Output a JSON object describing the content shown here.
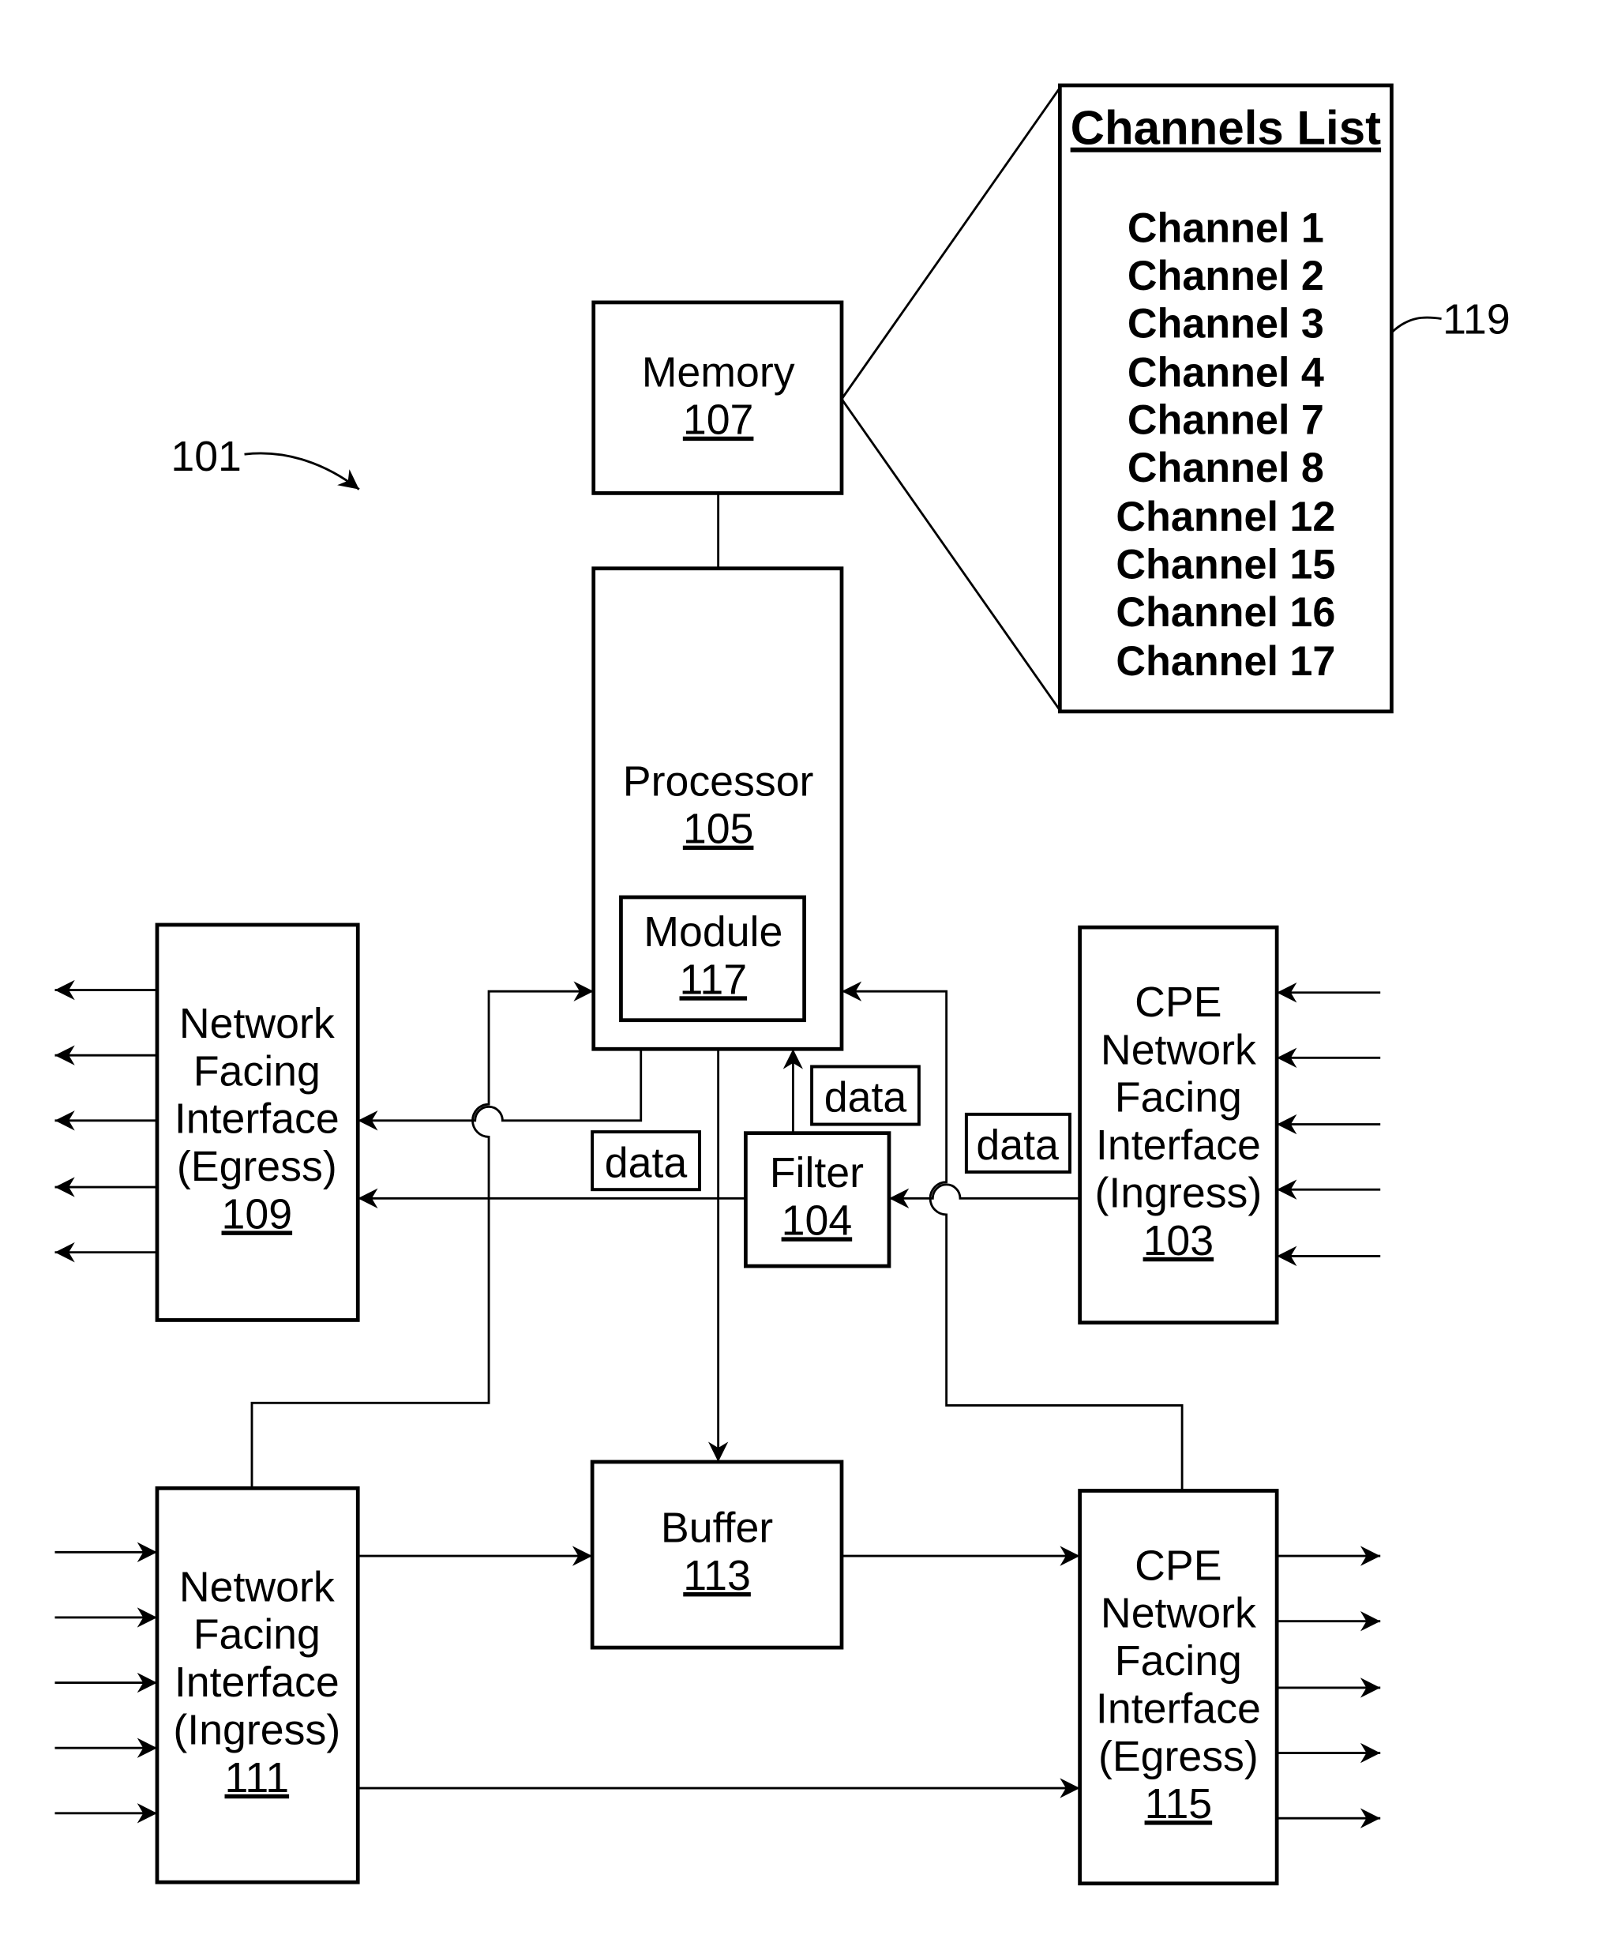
{
  "figure": {
    "reference_label": "101",
    "channels_list_ref": "119"
  },
  "blocks": {
    "memory": {
      "name": "Memory",
      "number": "107"
    },
    "processor": {
      "name": "Processor",
      "number": "105"
    },
    "module": {
      "name": "Module",
      "number": "117"
    },
    "filter": {
      "name": "Filter",
      "number": "104"
    },
    "buffer": {
      "name": "Buffer",
      "number": "113"
    },
    "nf_egress": {
      "lines": [
        "Network",
        "Facing",
        "Interface",
        "(Egress)"
      ],
      "number": "109"
    },
    "nf_ingress": {
      "lines": [
        "Network",
        "Facing",
        "Interface",
        "(Ingress)"
      ],
      "number": "111"
    },
    "cpe_ingress": {
      "lines": [
        "CPE",
        "Network",
        "Facing",
        "Interface",
        "(Ingress)"
      ],
      "number": "103"
    },
    "cpe_egress": {
      "lines": [
        "CPE",
        "Network",
        "Facing",
        "Interface",
        "(Egress)"
      ],
      "number": "115"
    }
  },
  "data_tags": [
    "data",
    "data",
    "data"
  ],
  "channels_list": {
    "title": "Channels List",
    "items": [
      "Channel 1",
      "Channel 2",
      "Channel 3",
      "Channel 4",
      "Channel 7",
      "Channel 8",
      "Channel 12",
      "Channel 15",
      "Channel 16",
      "Channel 17"
    ]
  }
}
